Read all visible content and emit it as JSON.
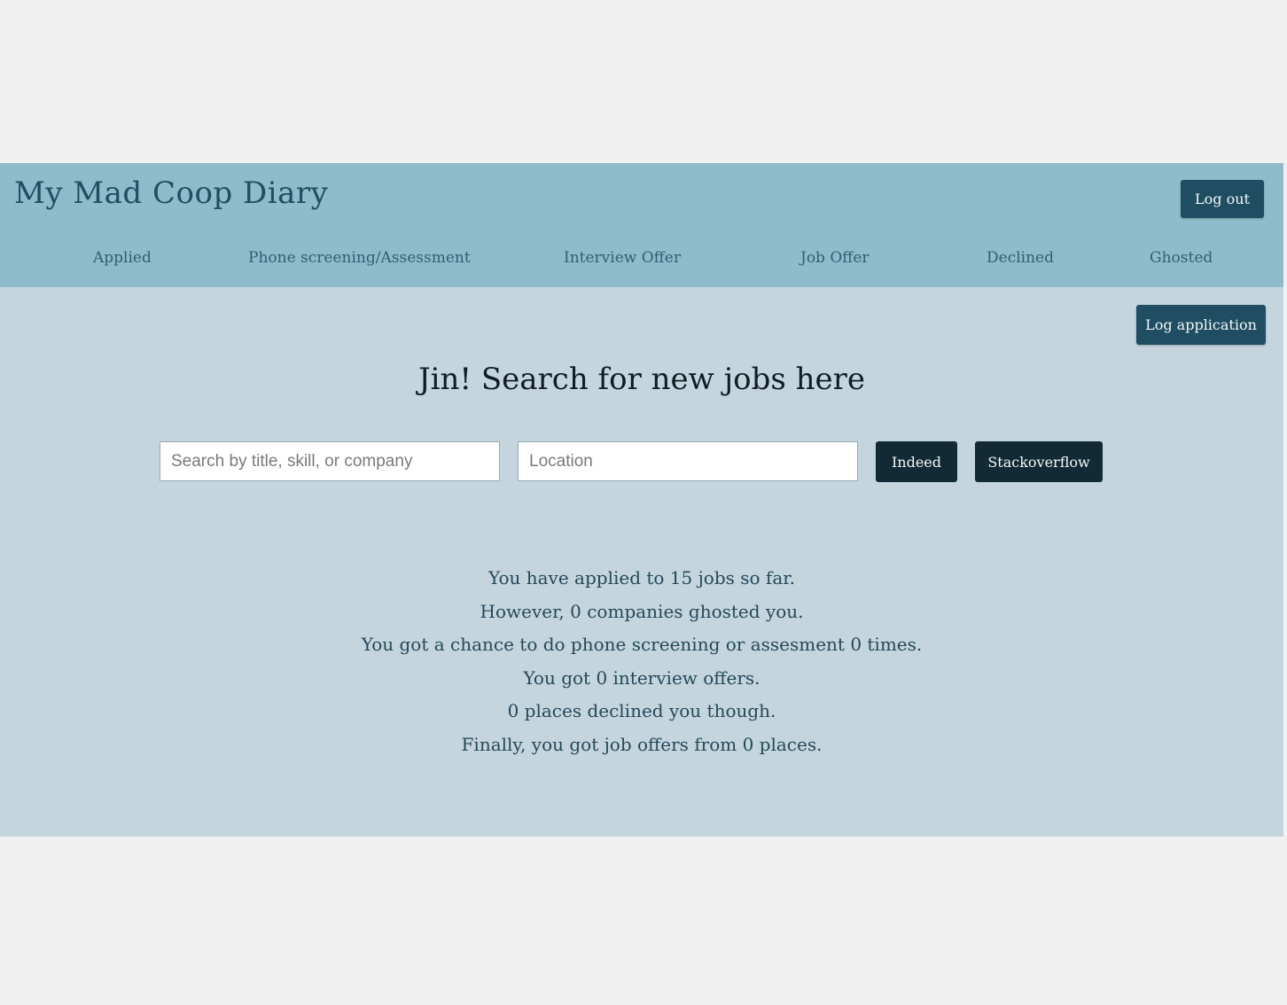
{
  "header": {
    "brand": "My Mad Coop Diary",
    "logout_label": "Log out"
  },
  "nav": {
    "items": [
      {
        "label": "Applied"
      },
      {
        "label": "Phone screening/Assessment"
      },
      {
        "label": "Interview Offer"
      },
      {
        "label": "Job Offer"
      },
      {
        "label": "Declined"
      },
      {
        "label": "Ghosted"
      }
    ]
  },
  "main": {
    "log_application_label": "Log application",
    "headline": "Jin! Search for new jobs here",
    "search": {
      "query_placeholder": "Search by title, skill, or company",
      "location_placeholder": "Location",
      "indeed_label": "Indeed",
      "stackoverflow_label": "Stackoverflow"
    },
    "stats": [
      "You have applied to 15 jobs so far.",
      "However, 0 companies ghosted you.",
      "You got a chance to do phone screening or assesment 0 times.",
      "You got 0 interview offers.",
      "0 places declined you though.",
      "Finally, you got job offers from 0 places."
    ]
  },
  "colors": {
    "header_bg": "#8fbccb",
    "content_bg": "#c5d5dd",
    "button_bg": "#1f4d61",
    "search_button_bg": "#122a35",
    "text_accent": "#1e4f62"
  }
}
